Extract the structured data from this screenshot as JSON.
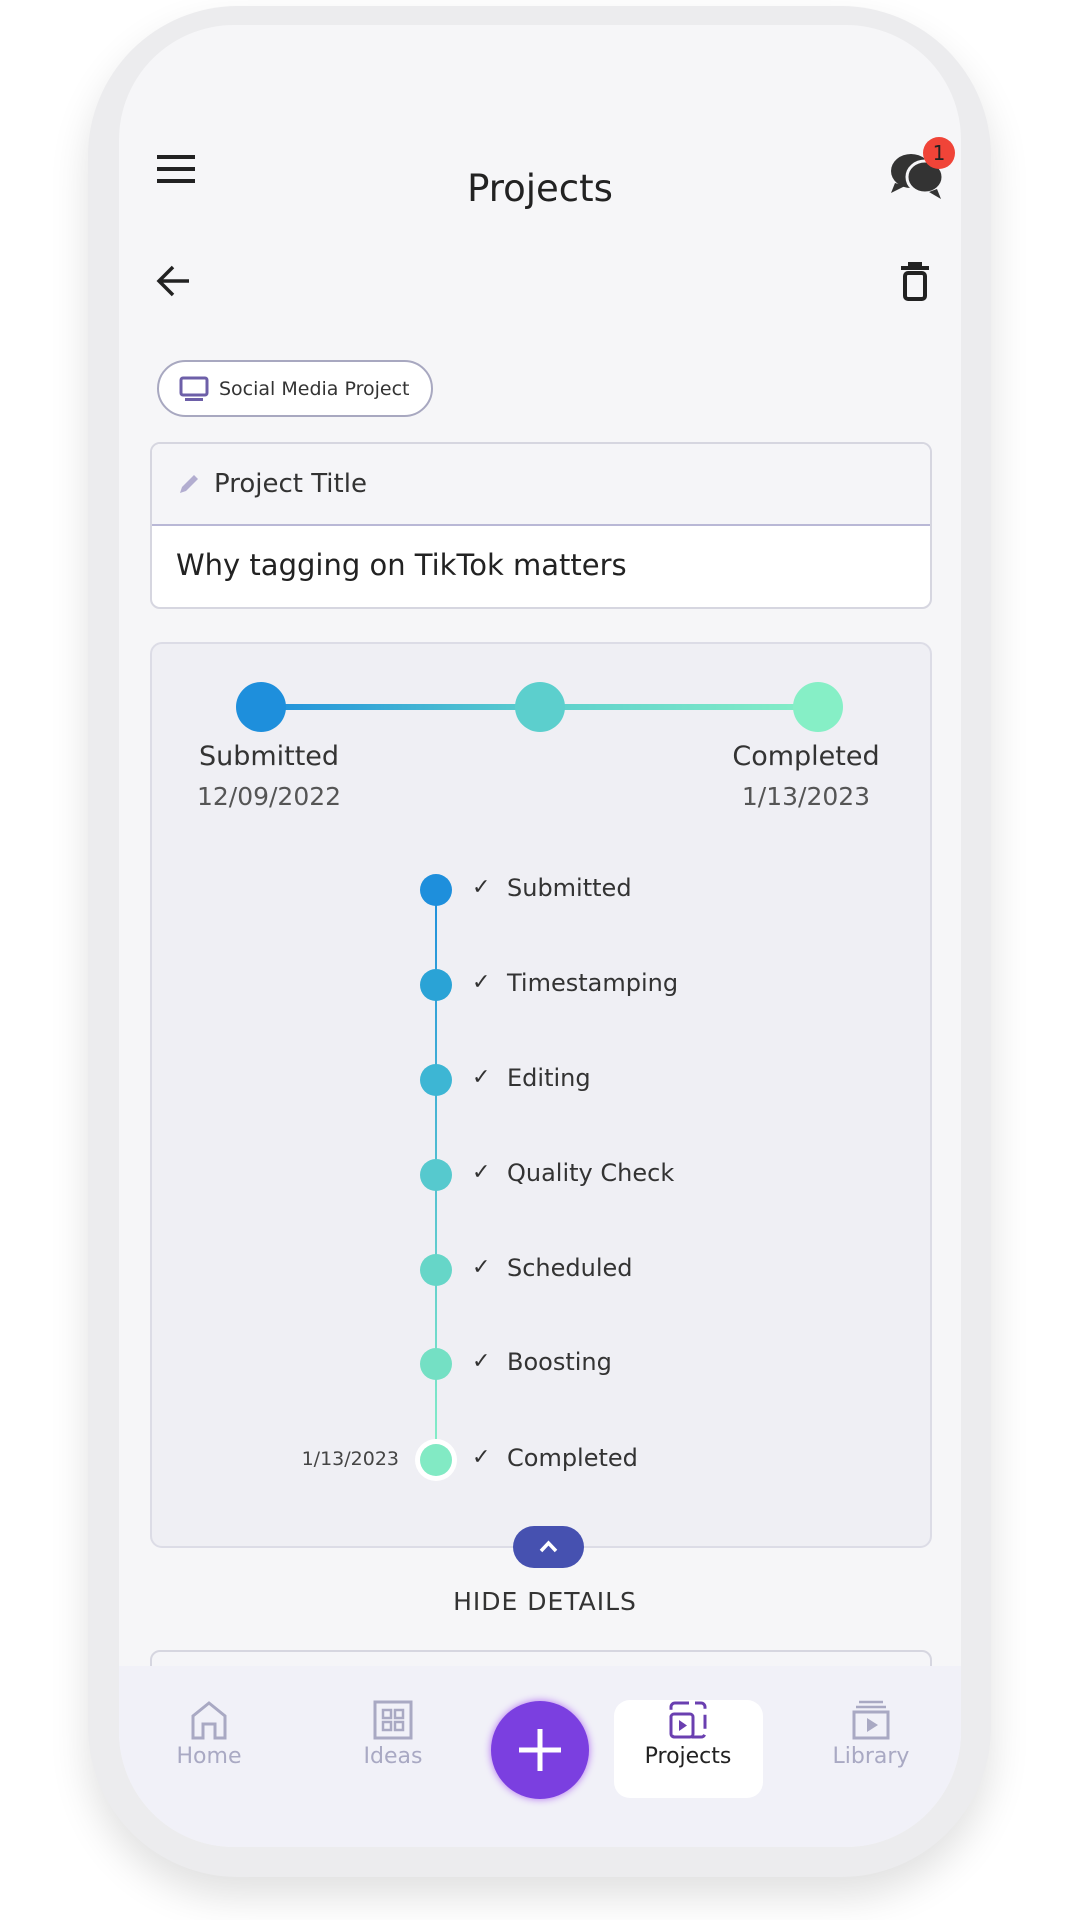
{
  "header": {
    "title": "Projects",
    "notification_count": "1"
  },
  "chip": {
    "label": "Social Media Project",
    "icon": "monitor-icon"
  },
  "project_title": {
    "label": "Project Title",
    "value": "Why tagging on TikTok matters"
  },
  "progress": {
    "start_label": "Submitted",
    "start_date": "12/09/2022",
    "end_label": "Completed",
    "end_date": "1/13/2023"
  },
  "timeline": {
    "steps": [
      {
        "label": "Submitted",
        "color": "#1e8fdc"
      },
      {
        "label": "Timestamping",
        "color": "#2aa3d6"
      },
      {
        "label": "Editing",
        "color": "#3db6d4"
      },
      {
        "label": "Quality Check",
        "color": "#56c9ce"
      },
      {
        "label": "Scheduled",
        "color": "#66d6c8"
      },
      {
        "label": "Boosting",
        "color": "#74e0c4"
      },
      {
        "label": "Completed",
        "color": "#82eac4",
        "date": "1/13/2023"
      }
    ]
  },
  "toggle": {
    "label": "HIDE DETAILS"
  },
  "nav": {
    "items": [
      {
        "label": "Home"
      },
      {
        "label": "Ideas"
      },
      {
        "label": "Projects",
        "active": true
      },
      {
        "label": "Library"
      }
    ]
  },
  "colors": {
    "accent": "#7b3fe0",
    "toggle": "#4651b0",
    "badge": "#f04438"
  }
}
